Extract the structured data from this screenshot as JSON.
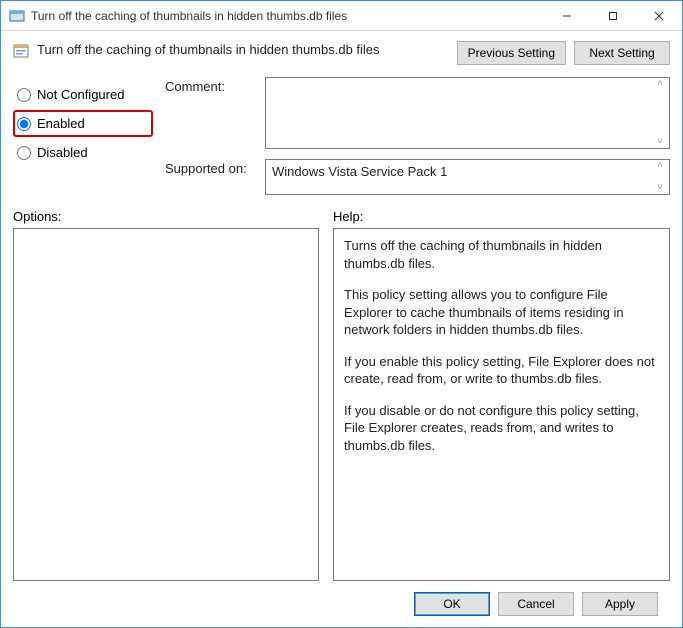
{
  "window": {
    "title": "Turn off the caching of thumbnails in hidden thumbs.db files"
  },
  "header": {
    "title": "Turn off the caching of thumbnails in hidden thumbs.db files",
    "previous_label": "Previous Setting",
    "next_label": "Next Setting"
  },
  "radios": {
    "not_configured": "Not Configured",
    "enabled": "Enabled",
    "disabled": "Disabled"
  },
  "comment": {
    "label": "Comment:",
    "value": ""
  },
  "supported": {
    "label": "Supported on:",
    "value": "Windows Vista Service Pack 1"
  },
  "labels": {
    "options": "Options:",
    "help": "Help:"
  },
  "help": {
    "p1": "Turns off the caching of thumbnails in hidden thumbs.db files.",
    "p2": "This policy setting allows you to configure File Explorer to cache thumbnails of items residing in network folders in hidden thumbs.db files.",
    "p3": "If you enable this policy setting, File Explorer does not create, read from, or write to thumbs.db files.",
    "p4": "If you disable or do not configure this policy setting, File Explorer creates, reads from, and writes to thumbs.db files."
  },
  "footer": {
    "ok": "OK",
    "cancel": "Cancel",
    "apply": "Apply"
  }
}
